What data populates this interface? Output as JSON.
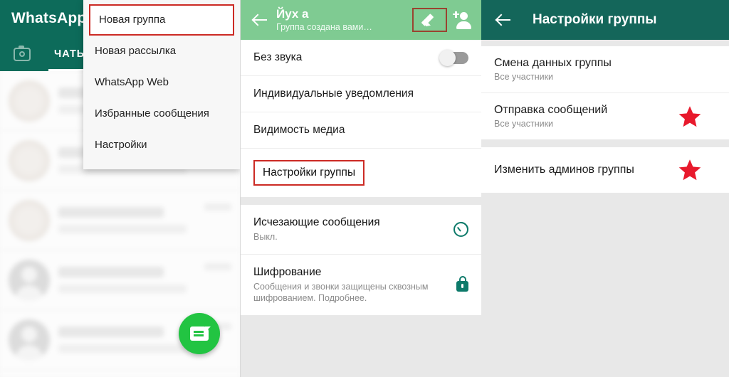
{
  "colors": {
    "wa_dark_teal": "#0d6b5a",
    "mid_header_green": "#7fcb92",
    "right_header_teal": "#14665a",
    "highlight_red": "#cc2a24",
    "pencil_box_red": "#9a4330",
    "star_red": "#e8192c",
    "fab_green": "#22c442",
    "icon_teal": "#0d7a6a"
  },
  "left_panel": {
    "app_title": "WhatsApp",
    "camera_icon": "camera-icon",
    "tabs": [
      {
        "label": "ЧАТЫ",
        "active": true
      }
    ],
    "fab_icon": "new-chat-icon",
    "menu": {
      "items": [
        {
          "label": "Новая группа",
          "highlighted": true
        },
        {
          "label": "Новая рассылка",
          "highlighted": false
        },
        {
          "label": "WhatsApp Web",
          "highlighted": false
        },
        {
          "label": "Избранные сообщения",
          "highlighted": false
        },
        {
          "label": "Настройки",
          "highlighted": false
        }
      ]
    }
  },
  "mid_panel": {
    "header": {
      "back_icon": "back-arrow-icon",
      "title": "Йух а",
      "subtitle": "Группа создана вами…",
      "edit_icon": "pencil-icon",
      "add_member_icon": "add-person-icon"
    },
    "rows": [
      {
        "label": "Без звука",
        "sub": "",
        "control": "toggle",
        "toggle_on": false,
        "highlighted": false
      },
      {
        "label": "Индивидуальные уведомления",
        "sub": "",
        "control": "none",
        "highlighted": false
      },
      {
        "label": "Видимость медиа",
        "sub": "",
        "control": "none",
        "highlighted": false
      },
      {
        "label": "Настройки группы",
        "sub": "",
        "control": "none",
        "highlighted": true
      }
    ],
    "rows2": [
      {
        "label": "Исчезающие сообщения",
        "sub": "Выкл.",
        "icon": "timer-icon"
      },
      {
        "label": "Шифрование",
        "sub": "Сообщения и звонки защищены сквозным шифрованием. Подробнее.",
        "icon": "lock-icon"
      }
    ]
  },
  "right_panel": {
    "header": {
      "back_icon": "back-arrow-icon",
      "title": "Настройки группы"
    },
    "group1": [
      {
        "label": "Смена данных группы",
        "sub": "Все участники",
        "star": false
      },
      {
        "label": "Отправка сообщений",
        "sub": "Все участники",
        "star": true
      }
    ],
    "group2": [
      {
        "label": "Изменить админов группы",
        "sub": "",
        "star": true
      }
    ]
  }
}
